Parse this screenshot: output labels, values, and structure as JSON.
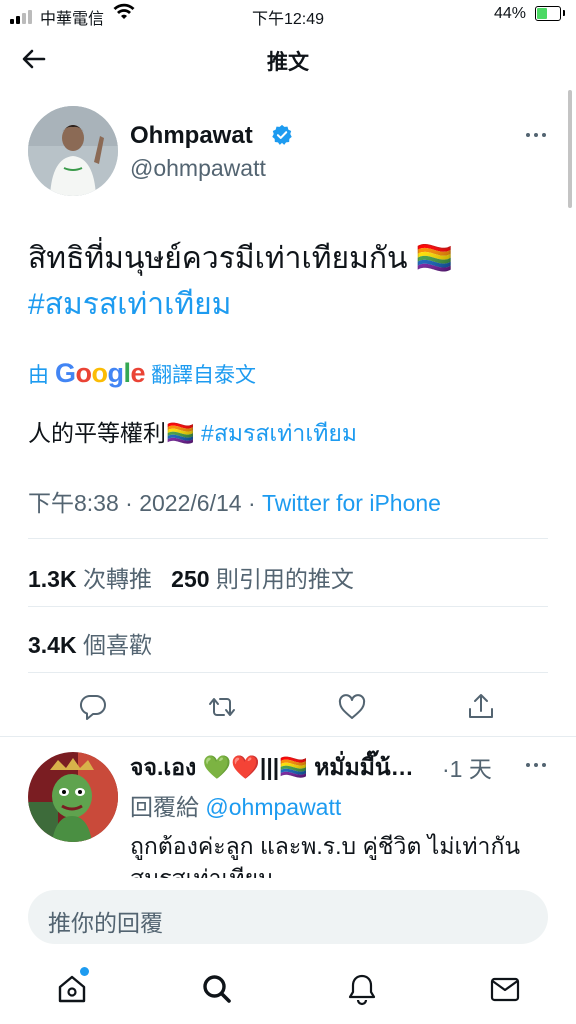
{
  "status_bar": {
    "carrier": "中華電信",
    "time": "下午12:49",
    "battery_percent": "44%",
    "battery_level": 0.44
  },
  "header": {
    "title": "推文"
  },
  "tweet": {
    "author_name": "Ohmpawat",
    "author_handle": "@ohmpawatt",
    "text": "สิทธิที่มนุษย์ควรมีเท่าเทียมกัน 🏳️‍🌈",
    "hashtag": "#สมรสเท่าเทียม",
    "translate_prefix": "由",
    "translate_brand": "Google",
    "translate_suffix": "翻譯自泰文",
    "translated_text": "人的平等權利🏳️‍🌈",
    "translated_hashtag": "#สมรสเท่าเทียม",
    "time": "下午8:38",
    "date": "2022/6/14",
    "source": "Twitter for iPhone",
    "retweets_count": "1.3K",
    "retweets_label": "次轉推",
    "quotes_count": "250",
    "quotes_label": "則引用的推文",
    "likes_count": "3.4K",
    "likes_label": "個喜歡"
  },
  "reply": {
    "author_name": "จจ.เอง 💚❤️|||🏳️‍🌈 หมั่มมี๊น้…",
    "time": "·1 天",
    "reply_to_label": "回覆給",
    "reply_to_handle": "@ohmpawatt",
    "text": "ถูกต้องค่ะลูก และพ.ร.บ คู่ชีวิต ไม่เท่ากัน สมรสเท่าเทียม"
  },
  "composer": {
    "placeholder": "推你的回覆"
  },
  "colors": {
    "accent": "#1d9bf0",
    "secondary_text": "#536471",
    "primary_text": "#0f1419"
  },
  "icons": [
    "back-arrow-icon",
    "verified-badge-icon",
    "more-icon",
    "reply-icon",
    "retweet-icon",
    "like-icon",
    "share-icon",
    "home-icon",
    "search-icon",
    "notifications-icon",
    "messages-icon",
    "wifi-icon",
    "signal-icon",
    "battery-icon"
  ]
}
